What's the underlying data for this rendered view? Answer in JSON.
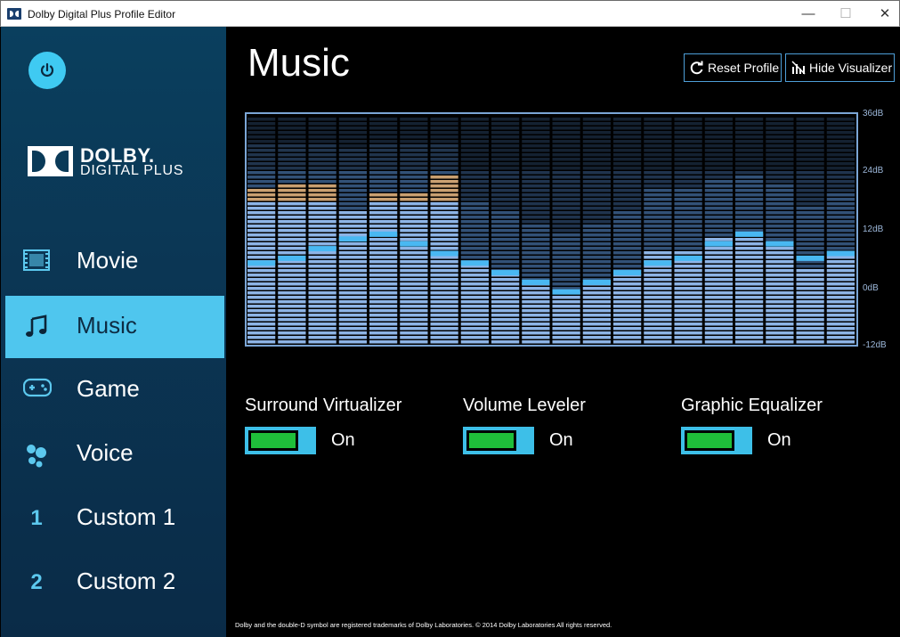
{
  "window": {
    "title": "Dolby Digital Plus Profile Editor",
    "minimize": "—",
    "maximize": "☐",
    "close": "✕"
  },
  "sidebar": {
    "logo_word": "DOLBY.",
    "logo_sub": "DIGITAL PLUS",
    "items": [
      {
        "label": "Movie",
        "icon": "film-icon",
        "glyph": "▦",
        "active": false
      },
      {
        "label": "Music",
        "icon": "music-note-icon",
        "glyph": "♫",
        "active": true
      },
      {
        "label": "Game",
        "icon": "gamepad-icon",
        "glyph": "⌨",
        "active": false
      },
      {
        "label": "Voice",
        "icon": "voice-icon",
        "glyph": "●",
        "active": false
      },
      {
        "label": "Custom 1",
        "icon": "number-one-icon",
        "glyph": "1",
        "active": false
      },
      {
        "label": "Custom 2",
        "icon": "number-two-icon",
        "glyph": "2",
        "active": false
      }
    ]
  },
  "main": {
    "title": "Music",
    "reset_label": "Reset Profile",
    "hide_label": "Hide Visualizer",
    "db_labels": [
      "36dB",
      "24dB",
      "12dB",
      "0dB",
      "-12dB"
    ],
    "features": [
      {
        "label": "Surround Virtualizer",
        "state": "On"
      },
      {
        "label": "Volume Leveler",
        "state": "On"
      },
      {
        "label": "Graphic Equalizer",
        "state": "On"
      }
    ],
    "footer": "Dolby and the double-D symbol are registered trademarks of Dolby Laboratories. © 2014 Dolby Laboratories All rights reserved."
  },
  "visualizer": {
    "range_db": [
      -12,
      36
    ],
    "bands": [
      {
        "level_db": 17.5,
        "peak_db": 20.5,
        "eq_db": 5
      },
      {
        "level_db": 17.5,
        "peak_db": 21.5,
        "eq_db": 6
      },
      {
        "level_db": 17.5,
        "peak_db": 21.5,
        "eq_db": 8
      },
      {
        "level_db": 16,
        "peak_db": null,
        "eq_db": 10
      },
      {
        "level_db": 17.5,
        "peak_db": 19.5,
        "eq_db": 11
      },
      {
        "level_db": 17.5,
        "peak_db": 19.5,
        "eq_db": 9
      },
      {
        "level_db": 17.5,
        "peak_db": 23.5,
        "eq_db": 7
      },
      {
        "level_db": 5,
        "peak_db": null,
        "eq_db": 5
      },
      {
        "level_db": 3,
        "peak_db": null,
        "eq_db": 3
      },
      {
        "level_db": 1,
        "peak_db": null,
        "eq_db": 1
      },
      {
        "level_db": -1,
        "peak_db": null,
        "eq_db": -1
      },
      {
        "level_db": 1,
        "peak_db": null,
        "eq_db": 1
      },
      {
        "level_db": 3,
        "peak_db": null,
        "eq_db": 3
      },
      {
        "level_db": 8,
        "peak_db": null,
        "eq_db": 5
      },
      {
        "level_db": 8,
        "peak_db": null,
        "eq_db": 6
      },
      {
        "level_db": 10,
        "peak_db": null,
        "eq_db": 9
      },
      {
        "level_db": 11,
        "peak_db": null,
        "eq_db": 11
      },
      {
        "level_db": 9,
        "peak_db": null,
        "eq_db": 9
      },
      {
        "level_db": 4,
        "peak_db": null,
        "eq_db": 6
      },
      {
        "level_db": 7,
        "peak_db": null,
        "eq_db": 7
      }
    ]
  }
}
